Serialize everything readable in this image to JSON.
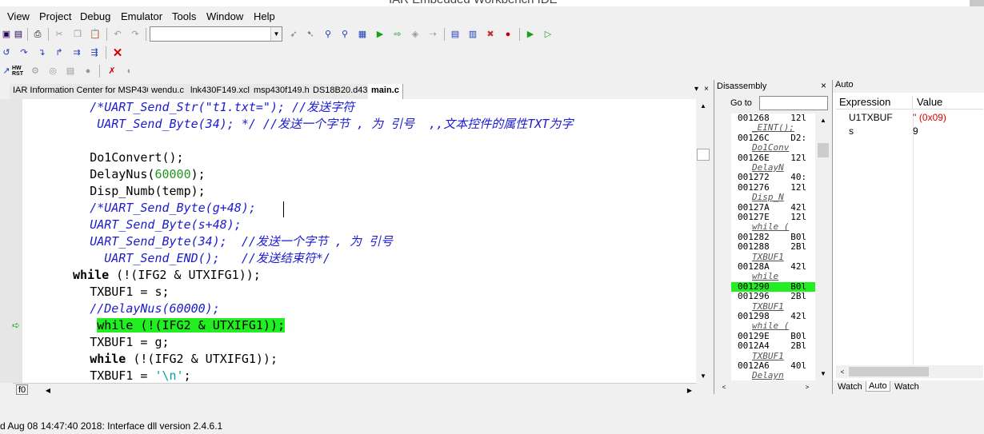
{
  "window": {
    "title": "IAR Embedded Workbench IDE"
  },
  "menu": [
    "View",
    "Project",
    "Debug",
    "Emulator",
    "Tools",
    "Window",
    "Help"
  ],
  "tabs": [
    {
      "label": "IAR Information Center for MSP430",
      "active": false
    },
    {
      "label": "wendu.c",
      "active": false
    },
    {
      "label": "lnk430F149.xcl",
      "active": false
    },
    {
      "label": "msp430f149.h",
      "active": false
    },
    {
      "label": "DS18B20.d43",
      "active": false
    },
    {
      "label": "main.c",
      "active": true
    }
  ],
  "editor": {
    "lines": [
      {
        "indent": 7,
        "parts": [
          {
            "t": "/*UART_Send_Str(\"t1.txt=\"); //发送字符",
            "c": "cm"
          }
        ]
      },
      {
        "indent": 7,
        "parts": [
          {
            "t": " UART_Send_Byte(34); */ //发送一个字节 , 为 引号  ,,文本控件的属性TXT为字",
            "c": "cm"
          }
        ]
      },
      {
        "indent": 7,
        "parts": []
      },
      {
        "indent": 7,
        "parts": [
          {
            "t": "Do1Convert();",
            "c": ""
          }
        ]
      },
      {
        "indent": 7,
        "parts": [
          {
            "t": "DelayNus(",
            "c": ""
          },
          {
            "t": "60000",
            "c": "num"
          },
          {
            "t": ");",
            "c": ""
          }
        ]
      },
      {
        "indent": 7,
        "parts": [
          {
            "t": "Disp_Numb(temp);",
            "c": ""
          }
        ]
      },
      {
        "indent": 7,
        "parts": [
          {
            "t": "/*UART_Send_Byte(g+48);",
            "c": "cm"
          }
        ]
      },
      {
        "indent": 7,
        "parts": [
          {
            "t": "UART_Send_Byte(s+48);",
            "c": "cm"
          }
        ]
      },
      {
        "indent": 7,
        "parts": [
          {
            "t": "UART_Send_Byte(34);  //发送一个字节 , 为 引号",
            "c": "cm"
          }
        ]
      },
      {
        "indent": 7,
        "parts": [
          {
            "t": "  UART_Send_END();   //发送结束符*/",
            "c": "cm"
          }
        ]
      },
      {
        "indent": 5,
        "parts": [
          {
            "t": "while",
            "c": "kw"
          },
          {
            "t": " (!(IFG2 & UTXIFG1));",
            "c": ""
          }
        ]
      },
      {
        "indent": 7,
        "parts": [
          {
            "t": "TXBUF1 = s;",
            "c": ""
          }
        ]
      },
      {
        "indent": 7,
        "parts": [
          {
            "t": "//DelayNus(60000);",
            "c": "cm"
          }
        ]
      },
      {
        "indent": 7,
        "parts": [
          {
            "t": " ",
            "c": ""
          },
          {
            "t": "while (!(IFG2 & UTXIFG1));",
            "c": "hl"
          }
        ]
      },
      {
        "indent": 7,
        "parts": [
          {
            "t": "TXBUF1 = g;",
            "c": ""
          }
        ]
      },
      {
        "indent": 7,
        "parts": [
          {
            "t": "while",
            "c": "kw"
          },
          {
            "t": " (!(IFG2 & UTXIFG1));",
            "c": ""
          }
        ]
      },
      {
        "indent": 7,
        "parts": [
          {
            "t": "TXBUF1 = ",
            "c": ""
          },
          {
            "t": "'\\n'",
            "c": "str"
          },
          {
            "t": ";",
            "c": ""
          }
        ]
      }
    ],
    "hscroll_label": "f0"
  },
  "disassembly": {
    "title": "Disassembly",
    "goto_label": "Go to",
    "rows": [
      {
        "addr": "001268",
        "code": "12l",
        "sub": false
      },
      {
        "addr": "",
        "code": "_EINT();",
        "sub": true
      },
      {
        "addr": "00126C",
        "code": "D2:",
        "sub": false
      },
      {
        "addr": "",
        "code": "Do1Conv",
        "sub": true
      },
      {
        "addr": "00126E",
        "code": "12l",
        "sub": false
      },
      {
        "addr": "",
        "code": "DelayN",
        "sub": true
      },
      {
        "addr": "001272",
        "code": "40:",
        "sub": false
      },
      {
        "addr": "001276",
        "code": "12l",
        "sub": false
      },
      {
        "addr": "",
        "code": "Disp_N",
        "sub": true
      },
      {
        "addr": "00127A",
        "code": "42l",
        "sub": false
      },
      {
        "addr": "00127E",
        "code": "12l",
        "sub": false
      },
      {
        "addr": "",
        "code": "while (",
        "sub": true
      },
      {
        "addr": "001282",
        "code": "B0l",
        "sub": false
      },
      {
        "addr": "001288",
        "code": "2Bl",
        "sub": false
      },
      {
        "addr": "",
        "code": "TXBUF1",
        "sub": true
      },
      {
        "addr": "00128A",
        "code": "42l",
        "sub": false
      },
      {
        "addr": "",
        "code": "while",
        "sub": true
      },
      {
        "addr": "001290",
        "code": "B0l",
        "sub": false,
        "current": true
      },
      {
        "addr": "001296",
        "code": "2Bl",
        "sub": false
      },
      {
        "addr": "",
        "code": "TXBUF1",
        "sub": true
      },
      {
        "addr": "001298",
        "code": "42l",
        "sub": false
      },
      {
        "addr": "",
        "code": "while (",
        "sub": true
      },
      {
        "addr": "00129E",
        "code": "B0l",
        "sub": false
      },
      {
        "addr": "0012A4",
        "code": "2Bl",
        "sub": false
      },
      {
        "addr": "",
        "code": "TXBUF1",
        "sub": true
      },
      {
        "addr": "0012A6",
        "code": "40l",
        "sub": false
      },
      {
        "addr": "",
        "code": "Delayn",
        "sub": true
      }
    ]
  },
  "auto": {
    "title": "Auto",
    "col_expression": "Expression",
    "col_value": "Value",
    "rows": [
      {
        "expr": "U1TXBUF",
        "value": "'' (0x09)",
        "value_color": "#e00000"
      },
      {
        "expr": "s",
        "value": "9",
        "value_color": "#000000"
      }
    ],
    "bottom_tabs": [
      "Watch",
      "Auto",
      "Watch"
    ]
  },
  "status": {
    "text": "d Aug 08 14:47:40 2018: Interface dll version 2.4.6.1"
  },
  "colors": {
    "comment": "#1b1bcf",
    "number": "#229922",
    "current_line": "#22ee22"
  }
}
